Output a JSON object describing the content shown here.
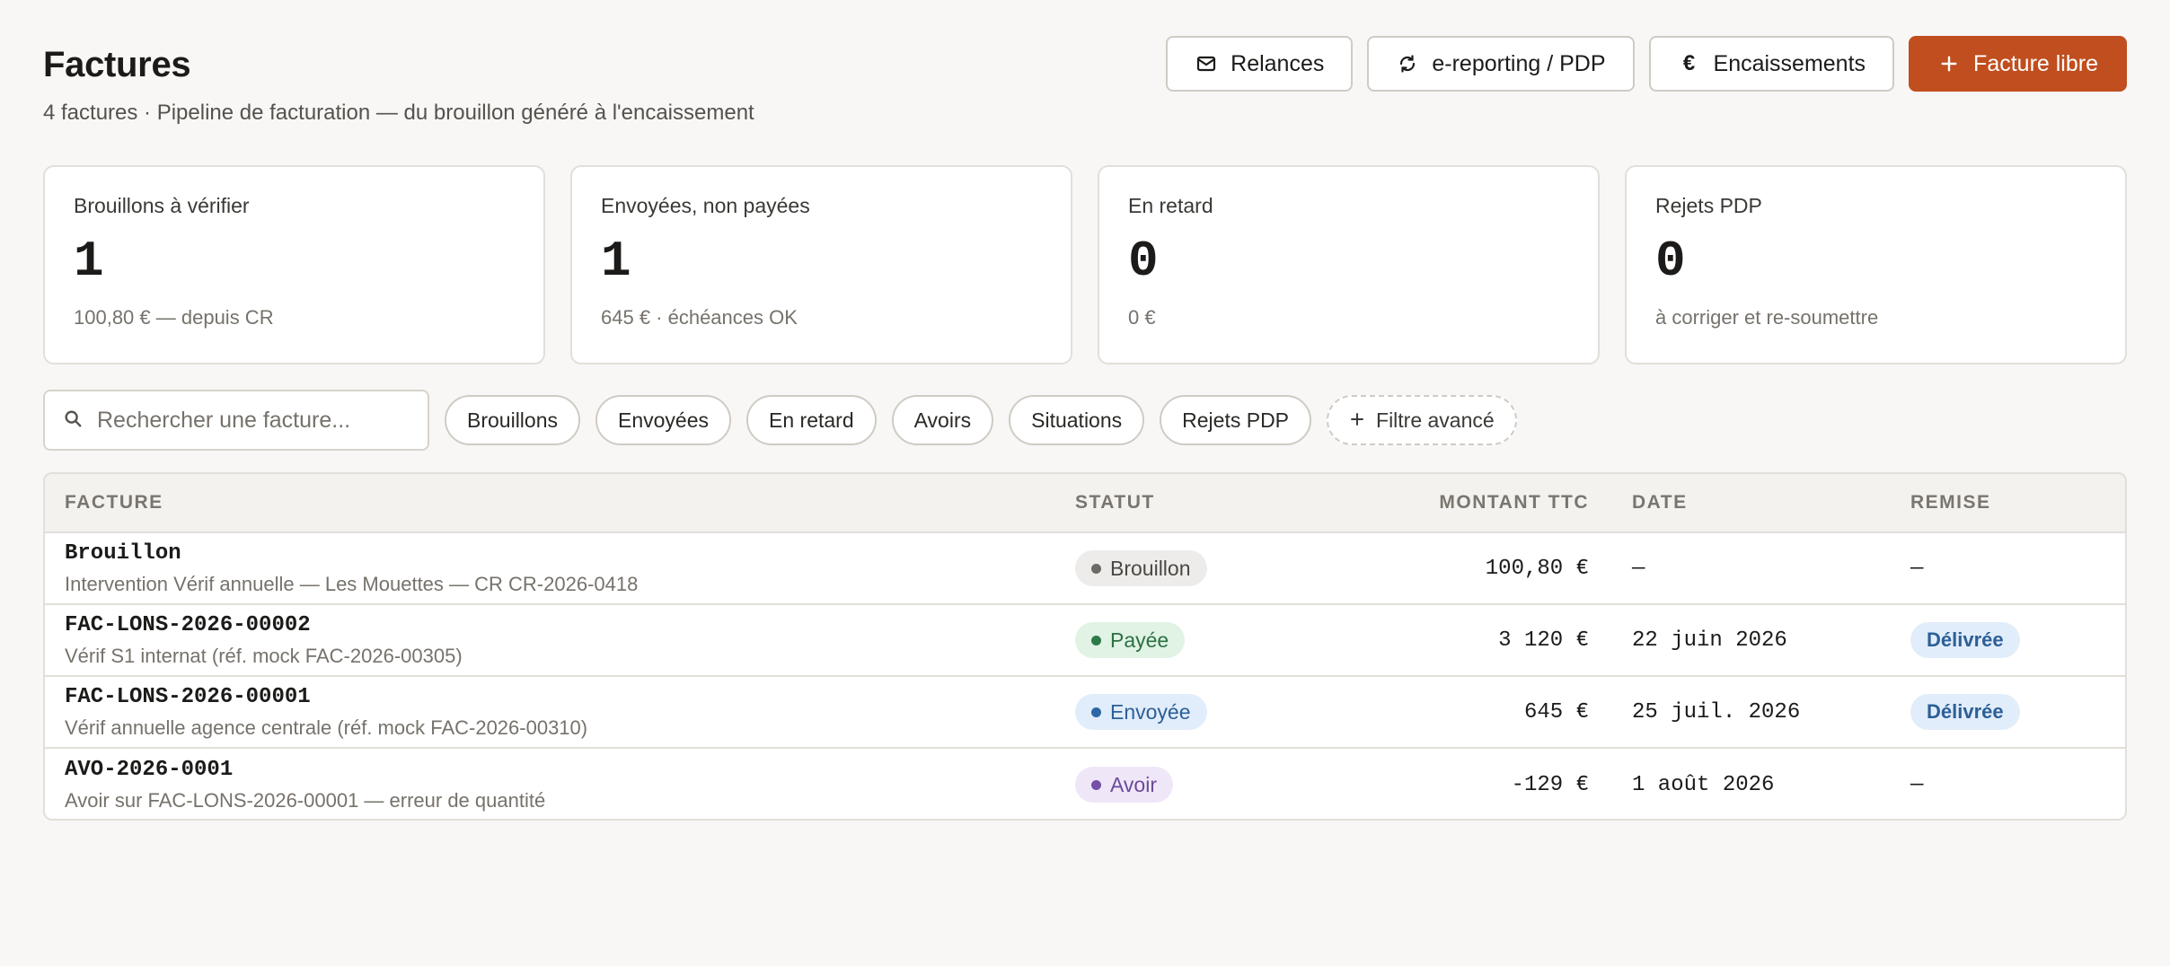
{
  "header": {
    "title": "Factures",
    "subtitle": "4 factures · Pipeline de facturation — du brouillon généré à l'encaissement"
  },
  "actions": {
    "relances": "Relances",
    "ereporting": "e-reporting / PDP",
    "encaissements": "Encaissements",
    "facture_libre": "Facture libre"
  },
  "stats": [
    {
      "label": "Brouillons à vérifier",
      "value": "1",
      "note": "100,80 € — depuis CR"
    },
    {
      "label": "Envoyées, non payées",
      "value": "1",
      "note": "645 € · échéances OK"
    },
    {
      "label": "En retard",
      "value": "0",
      "note": "0 €"
    },
    {
      "label": "Rejets PDP",
      "value": "0",
      "note": "à corriger et re-soumettre"
    }
  ],
  "search": {
    "placeholder": "Rechercher une facture..."
  },
  "filters": [
    "Brouillons",
    "Envoyées",
    "En retard",
    "Avoirs",
    "Situations",
    "Rejets PDP"
  ],
  "advanced_filter": "Filtre avancé",
  "table": {
    "headers": {
      "facture": "FACTURE",
      "statut": "STATUT",
      "montant": "MONTANT TTC",
      "date": "DATE",
      "remise": "REMISE"
    },
    "rows": [
      {
        "id": "Brouillon",
        "desc": "Intervention Vérif annuelle — Les Mouettes — CR CR-2026-0418",
        "status": "Brouillon",
        "amount": "100,80 €",
        "date": "—",
        "remise": "—"
      },
      {
        "id": "FAC-LONS-2026-00002",
        "desc": "Vérif S1 internat (réf. mock FAC-2026-00305)",
        "status": "Payée",
        "amount": "3 120 €",
        "date": "22 juin 2026",
        "remise": "Délivrée"
      },
      {
        "id": "FAC-LONS-2026-00001",
        "desc": "Vérif annuelle agence centrale (réf. mock FAC-2026-00310)",
        "status": "Envoyée",
        "amount": "645 €",
        "date": "25 juil. 2026",
        "remise": "Délivrée"
      },
      {
        "id": "AVO-2026-0001",
        "desc": "Avoir sur FAC-LONS-2026-00001 — erreur de quantité",
        "status": "Avoir",
        "amount": "-129 €",
        "date": "1 août 2026",
        "remise": "—"
      }
    ]
  },
  "colors": {
    "accent": "#c04e1e",
    "paid": "#2f7a49",
    "sent": "#2f66a6",
    "credit": "#7450a8",
    "draft": "#6d6964"
  }
}
